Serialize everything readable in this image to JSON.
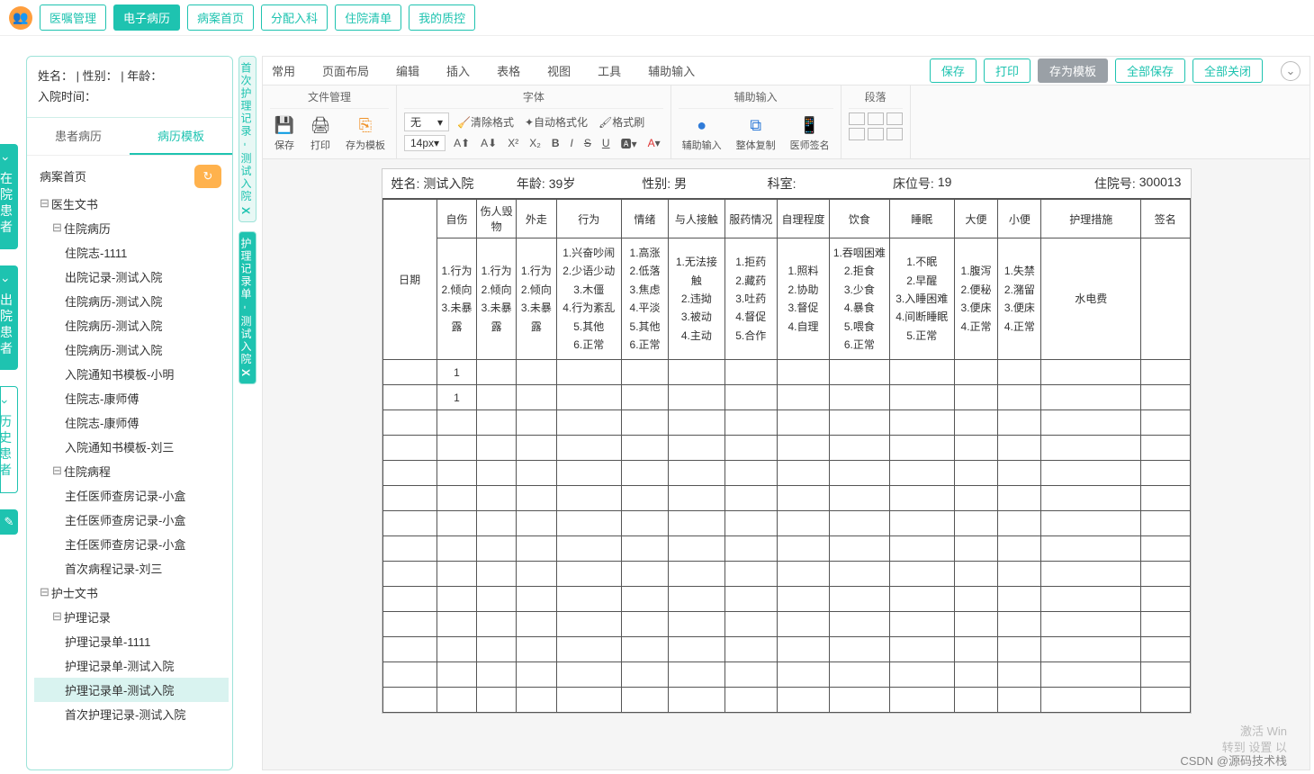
{
  "nav": {
    "items": [
      "医嘱管理",
      "电子病历",
      "病案首页",
      "分配入科",
      "住院清单",
      "我的质控"
    ],
    "active": 1
  },
  "patient_box": {
    "line1": "姓名：  | 性别：  | 年龄：",
    "line2": "入院时间："
  },
  "sb_tabs": {
    "a": "患者病历",
    "b": "病历模板"
  },
  "tree": [
    {
      "lvl": 1,
      "label": "病案首页",
      "refresh": true
    },
    {
      "lvl": 1,
      "label": "医生文书",
      "exp": true
    },
    {
      "lvl": 2,
      "label": "住院病历",
      "exp": true
    },
    {
      "lvl": 3,
      "label": "住院志-1111"
    },
    {
      "lvl": 3,
      "label": "出院记录-测试入院"
    },
    {
      "lvl": 3,
      "label": "住院病历-测试入院"
    },
    {
      "lvl": 3,
      "label": "住院病历-测试入院"
    },
    {
      "lvl": 3,
      "label": "住院病历-测试入院"
    },
    {
      "lvl": 3,
      "label": "入院通知书模板-小明"
    },
    {
      "lvl": 3,
      "label": "住院志-康师傅"
    },
    {
      "lvl": 3,
      "label": "住院志-康师傅"
    },
    {
      "lvl": 3,
      "label": "入院通知书模板-刘三"
    },
    {
      "lvl": 2,
      "label": "住院病程",
      "exp": true
    },
    {
      "lvl": 3,
      "label": "主任医师查房记录-小盒"
    },
    {
      "lvl": 3,
      "label": "主任医师查房记录-小盒"
    },
    {
      "lvl": 3,
      "label": "主任医师查房记录-小盒"
    },
    {
      "lvl": 3,
      "label": "首次病程记录-刘三"
    },
    {
      "lvl": 1,
      "label": "护士文书",
      "exp": true
    },
    {
      "lvl": 2,
      "label": "护理记录",
      "exp": true
    },
    {
      "lvl": 3,
      "label": "护理记录单-1111"
    },
    {
      "lvl": 3,
      "label": "护理记录单-测试入院"
    },
    {
      "lvl": 3,
      "label": "护理记录单-测试入院",
      "sel": true
    },
    {
      "lvl": 3,
      "label": "首次护理记录-测试入院"
    }
  ],
  "rail": [
    "在院患者",
    "出院患者",
    "历史患者"
  ],
  "vtabs": [
    {
      "label": "首次护理记录 - 测试入院",
      "close": "X"
    },
    {
      "label": "护理记录单 - 测试入院",
      "close": "X",
      "active": true
    }
  ],
  "ed_menu": [
    "常用",
    "页面布局",
    "编辑",
    "插入",
    "表格",
    "视图",
    "工具",
    "辅助输入"
  ],
  "ed_actions": {
    "save": "保存",
    "print": "打印",
    "template": "存为模板",
    "saveAll": "全部保存",
    "closeAll": "全部关闭"
  },
  "ribbon": {
    "g1": {
      "title": "文件管理",
      "save": "保存",
      "print": "打印",
      "tmpl": "存为模板"
    },
    "g2": {
      "title": "字体",
      "styleSel": "无",
      "clear": "清除格式",
      "auto": "自动格式化",
      "brush": "格式刷",
      "sizeSel": "14px"
    },
    "g3": {
      "title": "辅助输入",
      "a": "辅助输入",
      "b": "整体复制",
      "c": "医师签名"
    },
    "g4": {
      "title": "段落"
    }
  },
  "doc": {
    "head": {
      "name_l": "姓名:",
      "name_v": "测试入院",
      "age_l": "年龄:",
      "age_v": "39岁",
      "sex_l": "性别:",
      "sex_v": "男",
      "dept_l": "科室:",
      "dept_v": "",
      "bed_l": "床位号:",
      "bed_v": "19",
      "adm_l": "住院号:",
      "adm_v": "300013"
    },
    "cols": [
      "日期",
      "自伤",
      "伤人毁物",
      "外走",
      "行为",
      "情绪",
      "与人接触",
      "服药情况",
      "自理程度",
      "饮食",
      "睡眠",
      "大便",
      "小便",
      "护理措施",
      "签名"
    ],
    "opts": {
      "c1": [
        "1.行为",
        "2.倾向",
        "3.未暴露"
      ],
      "c2": [
        "1.行为",
        "2.倾向",
        "3.未暴露"
      ],
      "c3": [
        "1.行为",
        "2.倾向",
        "3.未暴露"
      ],
      "c4": [
        "1.兴奋吵闹",
        "2.少语少动",
        "3.木僵",
        "4.行为紊乱",
        "5.其他",
        "6.正常"
      ],
      "c5": [
        "1.高涨",
        "2.低落",
        "3.焦虑",
        "4.平淡",
        "5.其他",
        "6.正常"
      ],
      "c6": [
        "1.无法接触",
        "2.违拗",
        "3.被动",
        "4.主动"
      ],
      "c7": [
        "1.拒药",
        "2.藏药",
        "3.吐药",
        "4.督促",
        "5.合作"
      ],
      "c8": [
        "1.照料",
        "2.协助",
        "3.督促",
        "4.自理"
      ],
      "c9": [
        "1.吞咽困难",
        "2.拒食",
        "3.少食",
        "4.暴食",
        "5.喂食",
        "6.正常"
      ],
      "c10": [
        "1.不眠",
        "2.早醒",
        "3.入睡困难",
        "4.间断睡眠",
        "5.正常"
      ],
      "c11": [
        "1.腹泻",
        "2.便秘",
        "3.便床",
        "4.正常"
      ],
      "c12": [
        "1.失禁",
        "2.潴留",
        "3.便床",
        "4.正常"
      ],
      "c13": "水电费"
    },
    "rows": [
      [
        "",
        "1",
        "",
        "",
        "",
        "",
        "",
        "",
        "",
        "",
        "",
        "",
        "",
        "",
        ""
      ],
      [
        "",
        "1",
        "",
        "",
        "",
        "",
        "",
        "",
        "",
        "",
        "",
        "",
        "",
        "",
        ""
      ]
    ]
  },
  "watermark": {
    "l1": "激活 Win",
    "l2": "转到 设置 以"
  },
  "credit": "CSDN @源码技术栈"
}
